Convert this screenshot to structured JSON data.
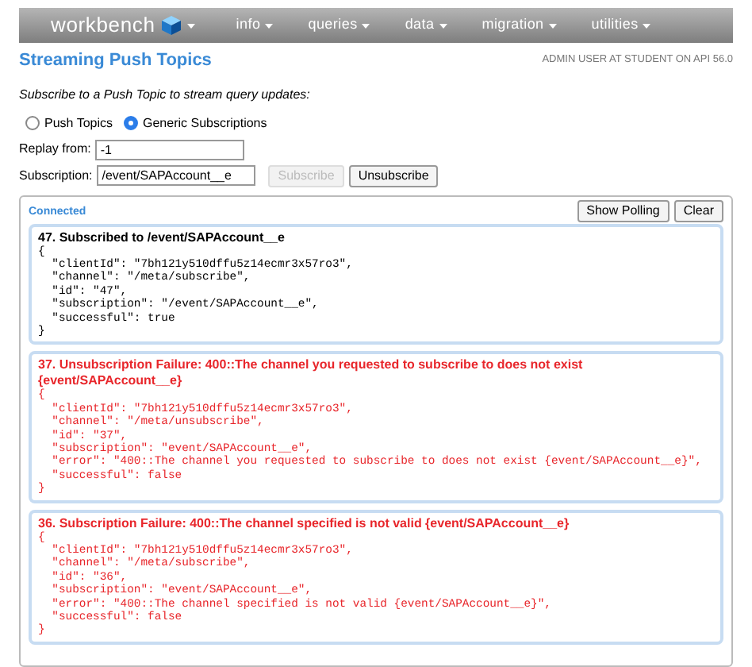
{
  "nav": {
    "logo": "workbench",
    "items": [
      {
        "label": "info"
      },
      {
        "label": "queries"
      },
      {
        "label": "data"
      },
      {
        "label": "migration"
      },
      {
        "label": "utilities"
      }
    ]
  },
  "page": {
    "title": "Streaming Push Topics",
    "user": "ADMIN USER AT STUDENT ON API 56.0",
    "intro": "Subscribe to a Push Topic to stream query updates:"
  },
  "modes": [
    {
      "label": "Push Topics",
      "selected": false
    },
    {
      "label": "Generic Subscriptions",
      "selected": true
    }
  ],
  "replay": {
    "label": "Replay from:",
    "value": "-1"
  },
  "subscription": {
    "label": "Subscription:",
    "value": "/event/SAPAccount__e",
    "subscribe": {
      "label": "Subscribe",
      "disabled": true
    },
    "unsubscribe": {
      "label": "Unsubscribe",
      "disabled": false
    }
  },
  "panel": {
    "status": "Connected",
    "buttons": [
      "Show Polling",
      "Clear"
    ]
  },
  "messages": [
    {
      "kind": "success",
      "title": "47. Subscribed to /event/SAPAccount__e",
      "body": "{\n  \"clientId\": \"7bh121y510dffu5z14ecmr3x57ro3\",\n  \"channel\": \"/meta/subscribe\",\n  \"id\": \"47\",\n  \"subscription\": \"/event/SAPAccount__e\",\n  \"successful\": true\n}"
    },
    {
      "kind": "failure",
      "title": "37. Unsubscription Failure: 400::The channel you requested to subscribe to does not exist {event/SAPAccount__e}",
      "body": "{\n  \"clientId\": \"7bh121y510dffu5z14ecmr3x57ro3\",\n  \"channel\": \"/meta/unsubscribe\",\n  \"id\": \"37\",\n  \"subscription\": \"event/SAPAccount__e\",\n  \"error\": \"400::The channel you requested to subscribe to does not exist {event/SAPAccount__e}\",\n  \"successful\": false\n}"
    },
    {
      "kind": "failure",
      "title": "36. Subscription Failure: 400::The channel specified is not valid {event/SAPAccount__e}",
      "body": "{\n  \"clientId\": \"7bh121y510dffu5z14ecmr3x57ro3\",\n  \"channel\": \"/meta/subscribe\",\n  \"id\": \"36\",\n  \"subscription\": \"event/SAPAccount__e\",\n  \"error\": \"400::The channel specified is not valid {event/SAPAccount__e}\",\n  \"successful\": false\n}"
    }
  ]
}
